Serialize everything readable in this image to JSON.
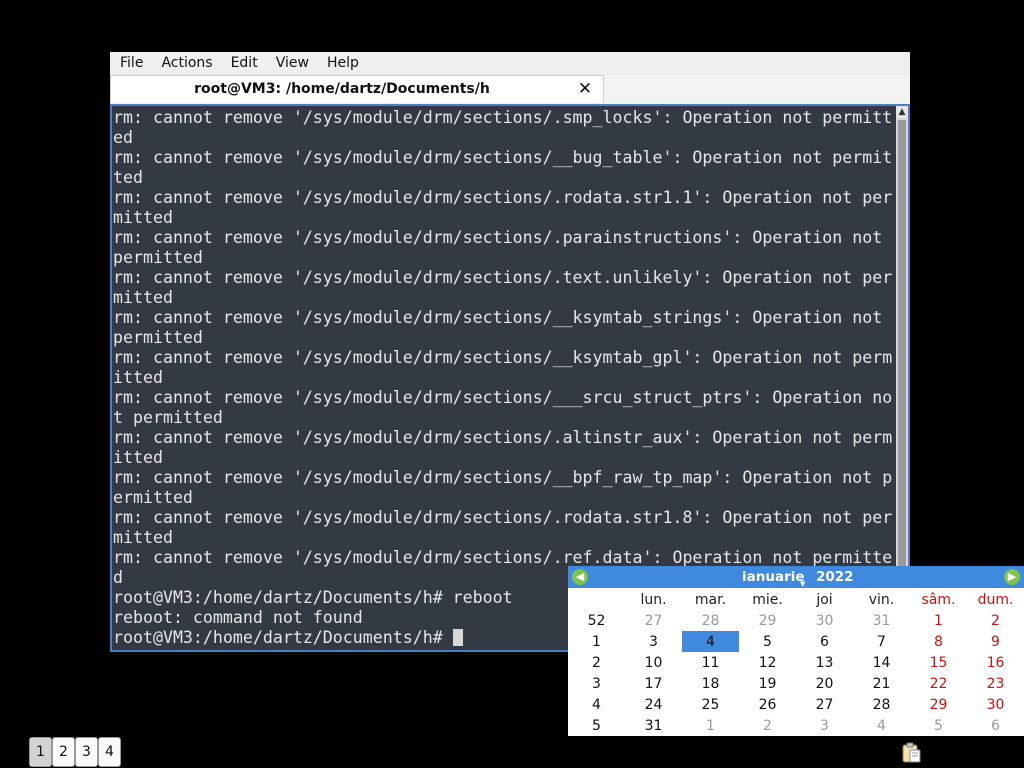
{
  "terminal": {
    "menu": [
      "File",
      "Actions",
      "Edit",
      "View",
      "Help"
    ],
    "tab_title": "root@VM3: /home/dartz/Documents/h",
    "close_symbol": "✕",
    "scroll_up_symbol": "▲",
    "lines": [
      "rm: cannot remove '/sys/module/drm/sections/.smp_locks': Operation not permitt",
      "ed",
      "rm: cannot remove '/sys/module/drm/sections/__bug_table': Operation not permit",
      "ted",
      "rm: cannot remove '/sys/module/drm/sections/.rodata.str1.1': Operation not per",
      "mitted",
      "rm: cannot remove '/sys/module/drm/sections/.parainstructions': Operation not",
      "permitted",
      "rm: cannot remove '/sys/module/drm/sections/.text.unlikely': Operation not per",
      "mitted",
      "rm: cannot remove '/sys/module/drm/sections/__ksymtab_strings': Operation not",
      "permitted",
      "rm: cannot remove '/sys/module/drm/sections/__ksymtab_gpl': Operation not perm",
      "itted",
      "rm: cannot remove '/sys/module/drm/sections/___srcu_struct_ptrs': Operation no",
      "t permitted",
      "rm: cannot remove '/sys/module/drm/sections/.altinstr_aux': Operation not perm",
      "itted",
      "rm: cannot remove '/sys/module/drm/sections/__bpf_raw_tp_map': Operation not p",
      "ermitted",
      "rm: cannot remove '/sys/module/drm/sections/.rodata.str1.8': Operation not per",
      "mitted",
      "rm: cannot remove '/sys/module/drm/sections/.ref.data': Operation not permitte",
      "d",
      "root@VM3:/home/dartz/Documents/h# reboot",
      "reboot: command not found"
    ],
    "prompt": "root@VM3:/home/dartz/Documents/h# "
  },
  "calendar": {
    "month": "ianuarie",
    "year": "2022",
    "prev_symbol": "◀",
    "next_symbol": "▶",
    "day_headers": [
      "lun.",
      "mar.",
      "mie.",
      "joi",
      "vin.",
      "sâm.",
      "dum."
    ],
    "weeks": [
      {
        "wn": "52",
        "days": [
          "27",
          "28",
          "29",
          "30",
          "31",
          "1",
          "2"
        ],
        "other": [
          0,
          1,
          2,
          3,
          4
        ]
      },
      {
        "wn": "1",
        "days": [
          "3",
          "4",
          "5",
          "6",
          "7",
          "8",
          "9"
        ],
        "other": []
      },
      {
        "wn": "2",
        "days": [
          "10",
          "11",
          "12",
          "13",
          "14",
          "15",
          "16"
        ],
        "other": []
      },
      {
        "wn": "3",
        "days": [
          "17",
          "18",
          "19",
          "20",
          "21",
          "22",
          "23"
        ],
        "other": []
      },
      {
        "wn": "4",
        "days": [
          "24",
          "25",
          "26",
          "27",
          "28",
          "29",
          "30"
        ],
        "other": []
      },
      {
        "wn": "5",
        "days": [
          "31",
          "1",
          "2",
          "3",
          "4",
          "5",
          "6"
        ],
        "other": [
          1,
          2,
          3,
          4,
          5,
          6
        ]
      }
    ],
    "today": {
      "week": 1,
      "day": 1
    },
    "colors": {
      "header": "#3f8ade",
      "weekend": "#d01010",
      "other_month": "#9a9a9a",
      "nav": "#7ec44b"
    }
  },
  "workspaces": {
    "items": [
      "1",
      "2",
      "3",
      "4"
    ],
    "active": 0
  },
  "tray": {
    "icon": "clipboard-icon"
  }
}
